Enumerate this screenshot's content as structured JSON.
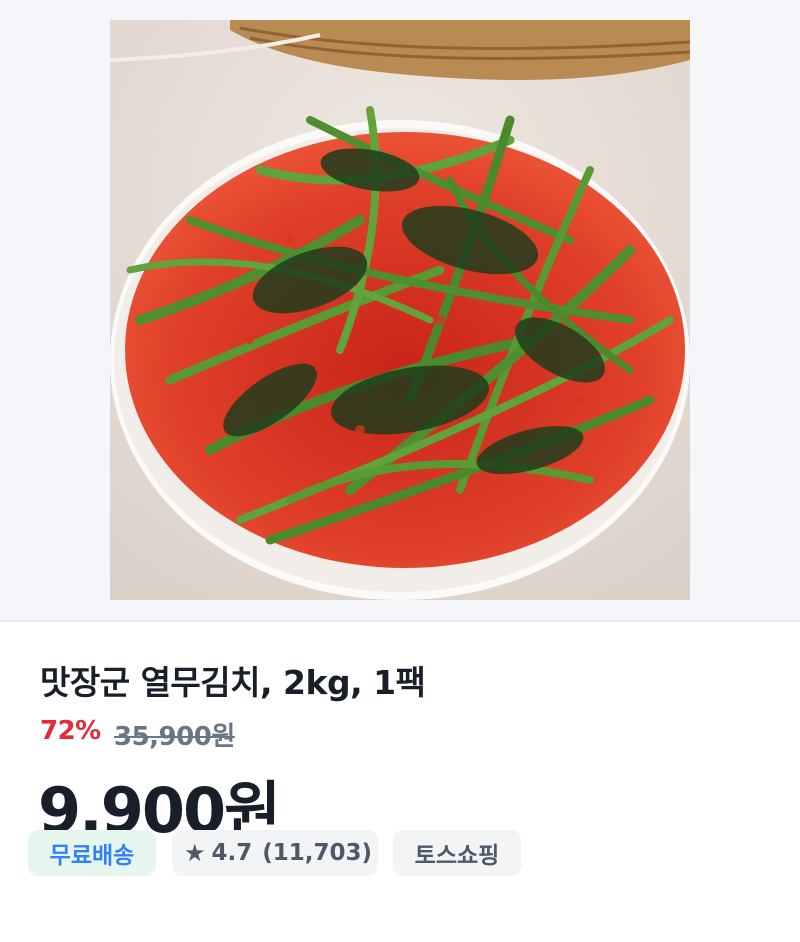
{
  "product": {
    "image_alt": "열무김치",
    "title": "맛장군 열무김치, 2kg, 1팩",
    "discount_rate": "72%",
    "original_price": "35,900원",
    "sale_price": "9,900원"
  },
  "chips": {
    "free_shipping": "무료배송",
    "rating": "4.7",
    "review_count": "(11,703)",
    "store": "토스쇼핑"
  },
  "icons": {
    "rating": "star-icon"
  },
  "colors": {
    "discount": "#e42939",
    "free_shipping_text": "#3182f6",
    "free_shipping_bg": "#e6f6ee",
    "chip_bg": "#f2f4f6"
  }
}
